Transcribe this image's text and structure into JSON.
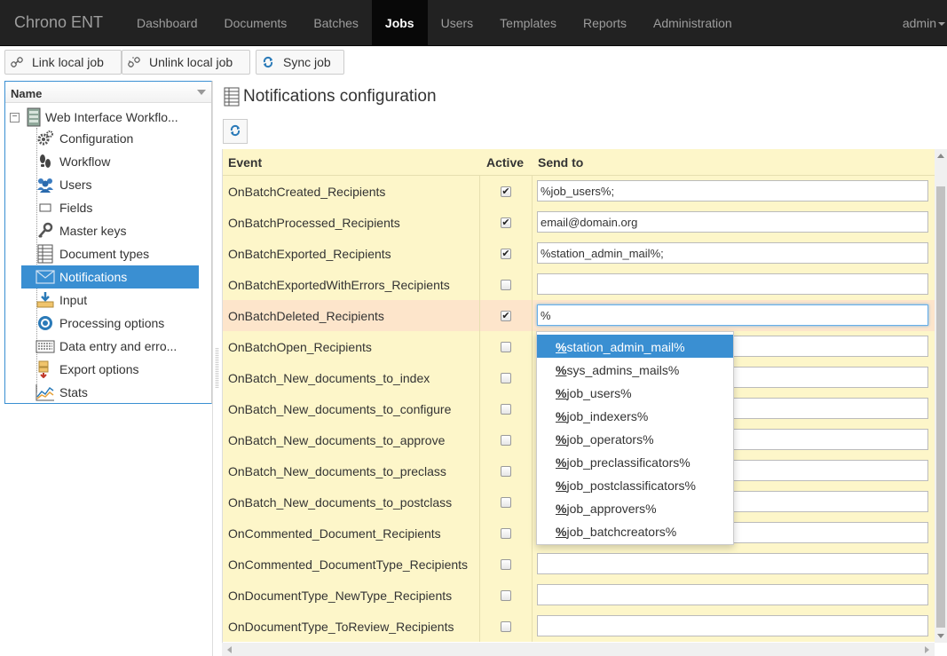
{
  "app": {
    "brand": "Chrono ENT",
    "user": "admin"
  },
  "nav": [
    "Dashboard",
    "Documents",
    "Batches",
    "Jobs",
    "Users",
    "Templates",
    "Reports",
    "Administration"
  ],
  "toolbar": {
    "link_label": "Link local job",
    "unlink_label": "Unlink local job",
    "sync_label": "Sync job"
  },
  "tree": {
    "header": "Name",
    "root": "Web Interface Workflo...",
    "items": [
      "Configuration",
      "Workflow",
      "Users",
      "Fields",
      "Master keys",
      "Document types",
      "Notifications",
      "Input",
      "Processing options",
      "Data entry and erro...",
      "Export options",
      "Stats"
    ],
    "selected": "Notifications"
  },
  "main": {
    "title": "Notifications configuration"
  },
  "grid": {
    "columns": {
      "event": "Event",
      "active": "Active",
      "send_to": "Send to"
    },
    "rows": [
      {
        "event": "OnBatchCreated_Recipients",
        "active": true,
        "send_to": "%job_users%;"
      },
      {
        "event": "OnBatchProcessed_Recipients",
        "active": true,
        "send_to": "email@domain.org"
      },
      {
        "event": "OnBatchExported_Recipients",
        "active": true,
        "send_to": "%station_admin_mail%;"
      },
      {
        "event": "OnBatchExportedWithErrors_Recipients",
        "active": false,
        "send_to": ""
      },
      {
        "event": "OnBatchDeleted_Recipients",
        "active": true,
        "send_to": "%"
      },
      {
        "event": "OnBatchOpen_Recipients",
        "active": false,
        "send_to": ""
      },
      {
        "event": "OnBatch_New_documents_to_index",
        "active": false,
        "send_to": ""
      },
      {
        "event": "OnBatch_New_documents_to_configure",
        "active": false,
        "send_to": ""
      },
      {
        "event": "OnBatch_New_documents_to_approve",
        "active": false,
        "send_to": ""
      },
      {
        "event": "OnBatch_New_documents_to_preclass",
        "active": false,
        "send_to": ""
      },
      {
        "event": "OnBatch_New_documents_to_postclass",
        "active": false,
        "send_to": ""
      },
      {
        "event": "OnCommented_Document_Recipients",
        "active": false,
        "send_to": ""
      },
      {
        "event": "OnCommented_DocumentType_Recipients",
        "active": false,
        "send_to": ""
      },
      {
        "event": "OnDocumentType_NewType_Recipients",
        "active": false,
        "send_to": ""
      },
      {
        "event": "OnDocumentType_ToReview_Recipients",
        "active": false,
        "send_to": ""
      }
    ]
  },
  "autocomplete": {
    "typed": "%",
    "suggestions": [
      "station_admin_mail%",
      "sys_admins_mails%",
      "job_users%",
      "job_indexers%",
      "job_operators%",
      "job_preclassificators%",
      "job_postclassificators%",
      "job_approvers%",
      "job_batchcreators%"
    ]
  },
  "colors": {
    "navbar": "#222222",
    "accent": "#3a8fd2",
    "grid_bg": "#fdf6c9",
    "row_highlight": "#fde5cb"
  }
}
